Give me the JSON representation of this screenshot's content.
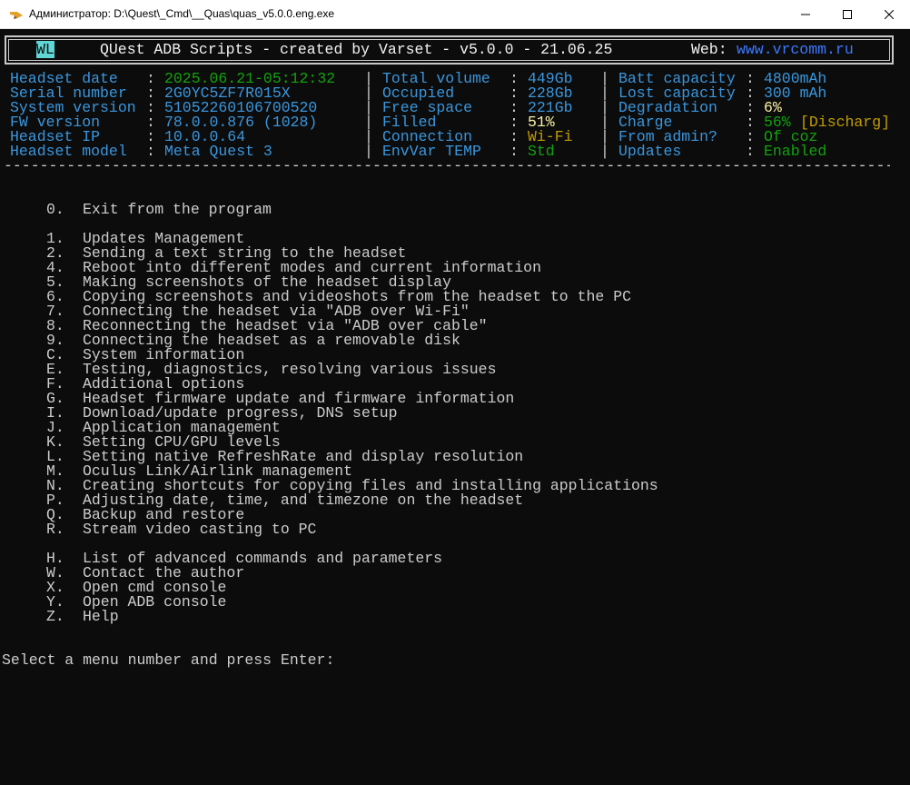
{
  "window": {
    "title": "Администратор: D:\\Quest\\_Cmd\\__Quas\\quas_v5.0.0.eng.exe"
  },
  "banner": {
    "tag": "WL",
    "text": "QUest ADB Scripts - created by Varset - v5.0.0 - 21.06.25",
    "web_label": "Web:",
    "web_url": "www.vrcomm.ru"
  },
  "info": {
    "col1": [
      {
        "label": "Headset date",
        "value": "2025.06.21-05:12:32"
      },
      {
        "label": "Serial number",
        "value": "2G0YC5ZF7R015X"
      },
      {
        "label": "System version",
        "value": "51052260106700520"
      },
      {
        "label": "FW version",
        "value": "78.0.0.876 (1028)"
      },
      {
        "label": "Headset IP",
        "value": "10.0.0.64"
      },
      {
        "label": "Headset model",
        "value": "Meta Quest 3"
      }
    ],
    "col2": [
      {
        "label": "Total volume",
        "value": "449Gb"
      },
      {
        "label": "Occupied",
        "value": "228Gb"
      },
      {
        "label": "Free space",
        "value": "221Gb"
      },
      {
        "label": "Filled",
        "value": "51%"
      },
      {
        "label": "Connection",
        "value": "Wi-Fi"
      },
      {
        "label": "EnvVar TEMP",
        "value": "Std"
      }
    ],
    "col3": [
      {
        "label": "Batt capacity",
        "value": "4800mAh"
      },
      {
        "label": "Lost capacity",
        "value": "300 mAh"
      },
      {
        "label": "Degradation",
        "value": "6%"
      },
      {
        "label": "Charge",
        "value": "56%",
        "extra": "[Discharg]"
      },
      {
        "label": "From admin?",
        "value": "Of coz"
      },
      {
        "label": "Updates",
        "value": "Enabled"
      }
    ],
    "separator": "-----------------------------------------------------------------------------------------------------------------------------"
  },
  "menu": {
    "exit": {
      "key": "0.",
      "label": "Exit from the program"
    },
    "main": [
      {
        "key": "1.",
        "label": "Updates Management"
      },
      {
        "key": "2.",
        "label": "Sending a text string to the headset"
      },
      {
        "key": "4.",
        "label": "Reboot into different modes and current information"
      },
      {
        "key": "5.",
        "label": "Making screenshots of the headset display"
      },
      {
        "key": "6.",
        "label": "Copying screenshots and videoshots from the headset to the PC"
      },
      {
        "key": "7.",
        "label": "Connecting the headset via \"ADB over Wi-Fi\""
      },
      {
        "key": "8.",
        "label": "Reconnecting the headset via \"ADB over cable\""
      },
      {
        "key": "9.",
        "label": "Connecting the headset as a removable disk"
      },
      {
        "key": "C.",
        "label": "System information"
      },
      {
        "key": "E.",
        "label": "Testing, diagnostics, resolving various issues"
      },
      {
        "key": "F.",
        "label": "Additional options"
      },
      {
        "key": "G.",
        "label": "Headset firmware update and firmware information"
      },
      {
        "key": "I.",
        "label": "Download/update progress, DNS setup"
      },
      {
        "key": "J.",
        "label": "Application management"
      },
      {
        "key": "K.",
        "label": "Setting CPU/GPU levels"
      },
      {
        "key": "L.",
        "label": "Setting native RefreshRate and display resolution"
      },
      {
        "key": "M.",
        "label": "Oculus Link/Airlink management"
      },
      {
        "key": "N.",
        "label": "Creating shortcuts for copying files and installing applications"
      },
      {
        "key": "P.",
        "label": "Adjusting date, time, and timezone on the headset"
      },
      {
        "key": "Q.",
        "label": "Backup and restore"
      },
      {
        "key": "R.",
        "label": "Stream video casting to PC"
      }
    ],
    "extra": [
      {
        "key": "H.",
        "label": "List of advanced commands and parameters"
      },
      {
        "key": "W.",
        "label": "Contact the author"
      },
      {
        "key": "X.",
        "label": "Open cmd console"
      },
      {
        "key": "Y.",
        "label": "Open ADB console"
      },
      {
        "key": "Z.",
        "label": "Help"
      }
    ]
  },
  "prompt": "Select a menu number and press Enter:",
  "colors": {
    "label": "#3a96dd",
    "value": "#13a10e",
    "warn": "#f9f1a5",
    "orange": "#c19c00",
    "background": "#0c0c0c",
    "text": "#cccccc"
  }
}
